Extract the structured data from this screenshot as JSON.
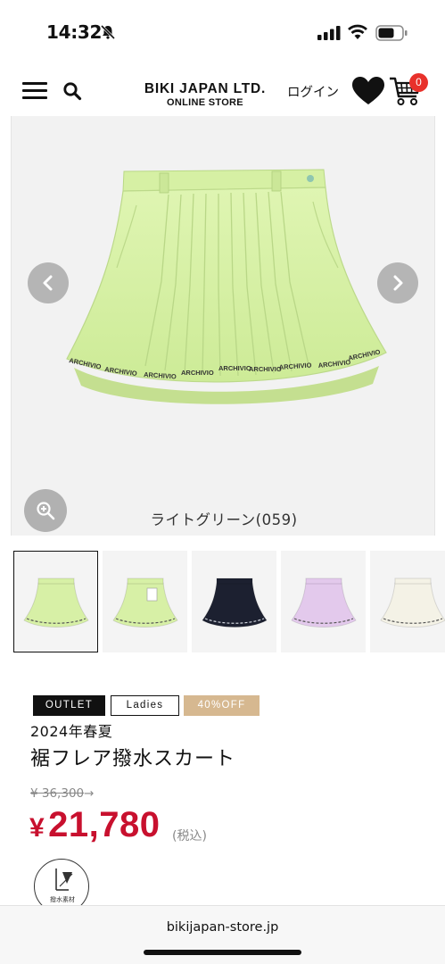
{
  "status_bar": {
    "time": "14:32",
    "icons": [
      "bell-slash-icon",
      "cellular-signal-icon",
      "wifi-icon",
      "battery-icon"
    ]
  },
  "header": {
    "menu_icon": "hamburger-menu-icon",
    "search_icon": "search-icon",
    "logo_main": "BIKI JAPAN LTD.",
    "logo_sub": "ONLINE STORE",
    "login_label": "ログイン",
    "favorites_icon": "heart-icon",
    "cart_icon": "shopping-cart-icon",
    "cart_count": "0"
  },
  "gallery": {
    "prev_icon": "chevron-left-icon",
    "next_icon": "chevron-right-icon",
    "zoom_icon": "zoom-in-icon",
    "color_caption": "ライトグリーン(059)",
    "skirt_print_text": "ARCHIVIO"
  },
  "thumbnails": [
    {
      "color": "#d7f0a6",
      "kind": "light green front",
      "active": true
    },
    {
      "color": "#d7f0a6",
      "kind": "light green back",
      "active": false
    },
    {
      "color": "#1c2030",
      "kind": "navy",
      "active": false
    },
    {
      "color": "#e3c9ec",
      "kind": "lavender",
      "active": false
    },
    {
      "color": "#f4f2e6",
      "kind": "white",
      "active": false
    }
  ],
  "product": {
    "badges": {
      "outlet": "OUTLET",
      "ladies": "Ladies",
      "discount": "40%OFF"
    },
    "season": "2024年春夏",
    "name": "裾フレア撥水スカート",
    "original_price": "¥ 36,300",
    "original_price_arrow": "→",
    "sale_currency": "¥",
    "sale_amount": "21,780",
    "tax_note": "(税込)",
    "feature_label": "撥水素材"
  },
  "browser": {
    "url": "bikijapan-store.jp"
  },
  "colors": {
    "sale_red": "#c8102e",
    "badge_off": "#d6b890",
    "cart_badge": "#e8312b",
    "skirt_green": "#d4f0a0"
  }
}
